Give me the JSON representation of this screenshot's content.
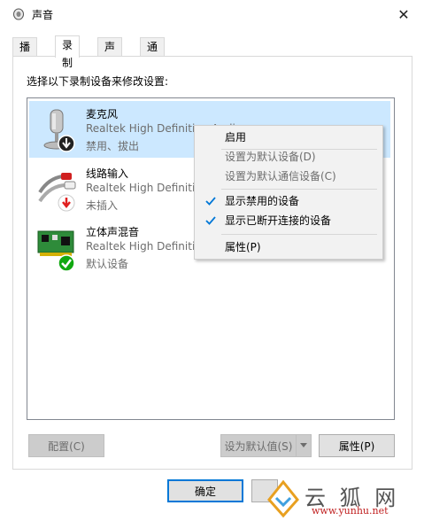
{
  "window": {
    "title": "声音",
    "close_glyph": "✕"
  },
  "tabs": [
    {
      "label": "播放",
      "active": false
    },
    {
      "label": "录制",
      "active": true
    },
    {
      "label": "声音",
      "active": false
    },
    {
      "label": "通信",
      "active": false
    }
  ],
  "instruction": "选择以下录制设备来修改设置:",
  "devices": [
    {
      "name": "麦克风",
      "driver": "Realtek High Definition Audio",
      "status": "禁用、拔出",
      "icon": "microphone-icon",
      "badge": "disabled-down-arrow-icon",
      "selected": true
    },
    {
      "name": "线路输入",
      "driver": "Realtek High Definition Audio",
      "status": "未插入",
      "icon": "line-in-cable-icon",
      "badge": "unplugged-red-arrow-icon",
      "selected": false
    },
    {
      "name": "立体声混音",
      "driver": "Realtek High Definition Audio",
      "status": "默认设备",
      "icon": "sound-card-icon",
      "badge": "default-check-icon",
      "selected": false
    }
  ],
  "context_menu": {
    "items": [
      {
        "label": "启用",
        "enabled": true,
        "checked": false
      },
      {
        "label": "设置为默认设备(D)",
        "enabled": false,
        "checked": false
      },
      {
        "label": "设置为默认通信设备(C)",
        "enabled": false,
        "checked": false
      },
      {
        "label": "显示禁用的设备",
        "enabled": true,
        "checked": true
      },
      {
        "label": "显示已断开连接的设备",
        "enabled": true,
        "checked": true
      },
      {
        "label": "属性(P)",
        "enabled": true,
        "checked": false
      }
    ]
  },
  "buttons": {
    "configure": "配置(C)",
    "set_default": "设为默认值(S)",
    "properties": "属性(P)",
    "ok": "确定"
  },
  "watermark": {
    "brand": "云 狐 网",
    "url": "www.yunhu.net"
  },
  "colors": {
    "selection": "#cce8ff",
    "accent": "#0078d7",
    "check_blue": "#0078d7",
    "badge_green": "#10a810",
    "badge_red": "#e02020"
  }
}
